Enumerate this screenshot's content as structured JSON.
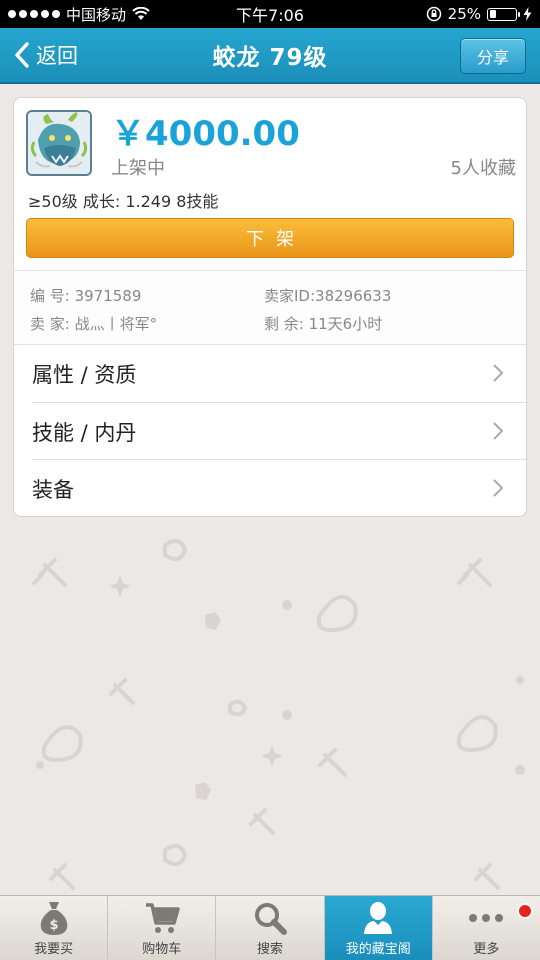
{
  "status_bar": {
    "carrier": "中国移动",
    "time": "下午7:06",
    "battery": "25%",
    "battery_level": 0.25
  },
  "nav": {
    "back_label": "返回",
    "title": "蛟龙 79级",
    "share_label": "分享"
  },
  "item": {
    "price": "￥4000.00",
    "status": "上架中",
    "favorites": "5人收藏",
    "summary": "≥50级 成长: 1.249  8技能",
    "delist_label": "下架"
  },
  "info": {
    "serial": "编  号: 3971589",
    "seller_id": "卖家ID:38296633",
    "seller": "卖  家: 战灬丨将军°",
    "remaining": "剩  余:  11天6小时"
  },
  "menu": [
    {
      "label": "属性 / 资质"
    },
    {
      "label": "技能 / 内丹"
    },
    {
      "label": "装备"
    }
  ],
  "tabs": [
    {
      "label": "我要买",
      "icon": "money-bag-icon"
    },
    {
      "label": "购物车",
      "icon": "cart-icon"
    },
    {
      "label": "搜索",
      "icon": "search-icon"
    },
    {
      "label": "我的藏宝阁",
      "icon": "user-icon",
      "active": true
    },
    {
      "label": "更多",
      "icon": "more-dots-icon"
    }
  ],
  "colors": {
    "accent": "#1b8fba",
    "price": "#1aa3d8",
    "delist_button": "#f0a423",
    "badge": "#e8231e"
  }
}
